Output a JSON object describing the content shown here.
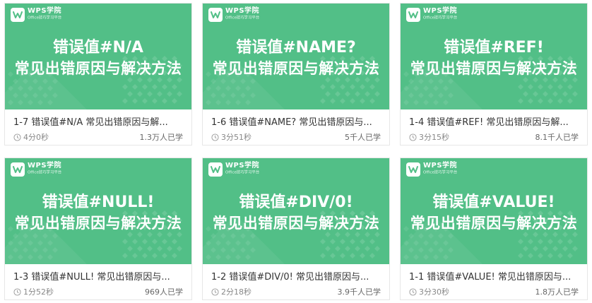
{
  "colors": {
    "thumb_bg": "#52bf87",
    "title_text": "#333333",
    "meta_text": "#888888"
  },
  "logo": {
    "name": "WPS学院",
    "subtitle": "Office技巧学习平台",
    "icon": "wps-logo-icon"
  },
  "cards": [
    {
      "thumb_line1": "错误值#N/A",
      "thumb_line2": "常见出错原因与解决方法",
      "title": "1-7 错误值#N/A 常见出错原因与解...",
      "duration": "4分0秒",
      "views": "1.3万人已学"
    },
    {
      "thumb_line1": "错误值#NAME?",
      "thumb_line2": "常见出错原因与解决方法",
      "title": "1-6 错误值#NAME? 常见出错原因与...",
      "duration": "3分51秒",
      "views": "5千人已学"
    },
    {
      "thumb_line1": "错误值#REF!",
      "thumb_line2": "常见出错原因与解决方法",
      "title": "1-4 错误值#REF! 常见出错原因与解...",
      "duration": "3分15秒",
      "views": "8.1千人已学"
    },
    {
      "thumb_line1": "错误值#NULL!",
      "thumb_line2": "常见出错原因与解决方法",
      "title": "1-3 错误值#NULL! 常见出错原因与...",
      "duration": "1分52秒",
      "views": "969人已学"
    },
    {
      "thumb_line1": "错误值#DIV/0!",
      "thumb_line2": "常见出错原因与解决方法",
      "title": "1-2 错误值#DIV/0! 常见出错原因与...",
      "duration": "2分18秒",
      "views": "3.9千人已学"
    },
    {
      "thumb_line1": "错误值#VALUE!",
      "thumb_line2": "常见出错原因与解决方法",
      "title": "1-1 错误值#VALUE! 常见出错原因与...",
      "duration": "3分30秒",
      "views": "1.8万人已学"
    }
  ]
}
